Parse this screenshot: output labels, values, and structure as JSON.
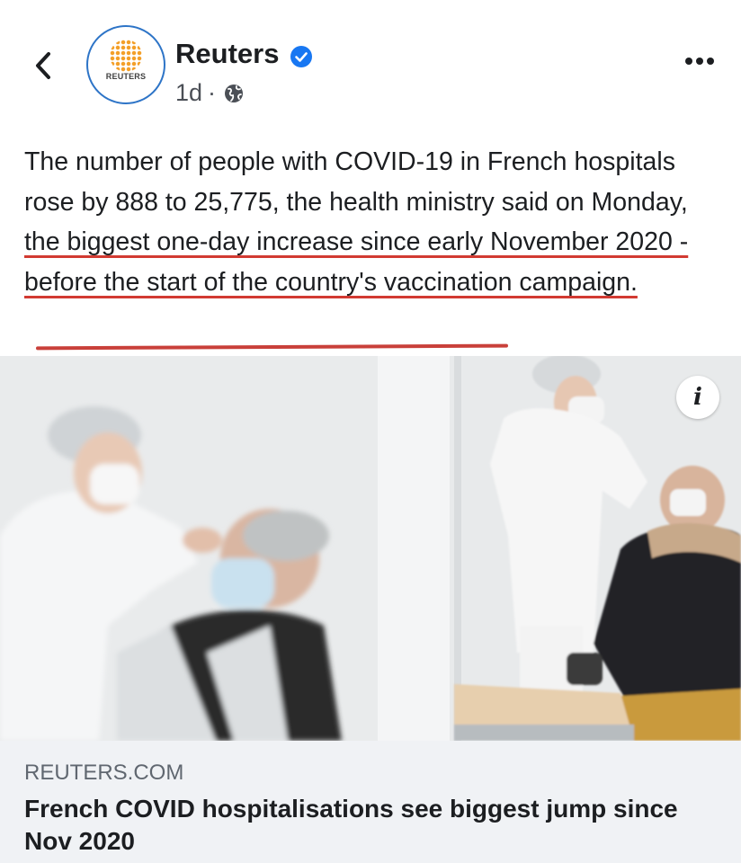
{
  "post": {
    "page_name": "Reuters",
    "avatar_text": "REUTERS",
    "time": "1d",
    "separator": "·",
    "text_plain": "The number of people with COVID-19 in French hospitals rose by 888 to 25,775, the health ministry said on Monday, ",
    "text_highlight": "the biggest one-day increase since early November 2020 - before the start of the country's vaccination campaign.",
    "icons": {
      "back": "chevron-left-icon",
      "verified": "verified-badge-icon",
      "audience": "globe-icon",
      "more": "more-options-icon",
      "info": "info-icon"
    }
  },
  "link_preview": {
    "domain": "REUTERS.COM",
    "title": "French COVID hospitalisations see biggest jump since Nov 2020",
    "info_glyph": "i"
  },
  "colors": {
    "verified": "#1877f2",
    "underline": "#d23a32",
    "card_bg": "#f0f2f5"
  }
}
